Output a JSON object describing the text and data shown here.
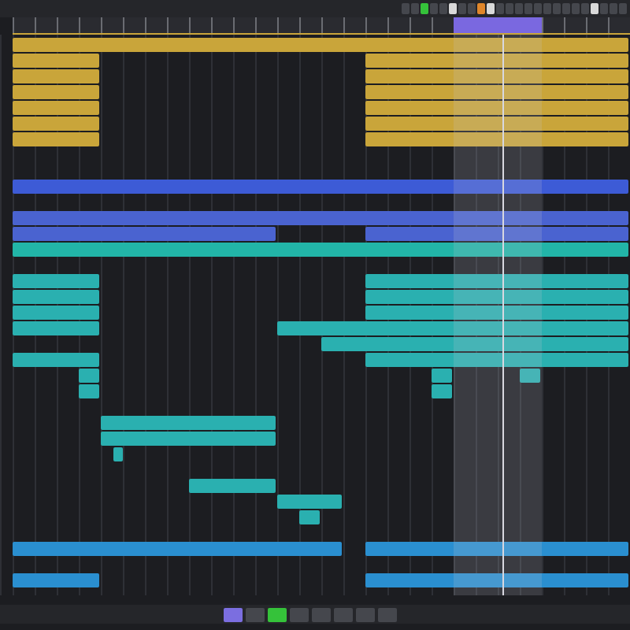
{
  "toolbar": {
    "buttons": [
      {
        "selected": false
      },
      {
        "selected": false
      },
      {
        "selected": true,
        "color": "#35c23a"
      },
      {
        "selected": false
      },
      {
        "selected": false
      },
      {
        "selected": true,
        "color": "#d9d9d9"
      },
      {
        "selected": false
      },
      {
        "selected": false
      },
      {
        "selected": true,
        "color": "#e0862a"
      },
      {
        "selected": true,
        "color": "#d9d9d9"
      },
      {
        "selected": false
      },
      {
        "selected": false
      },
      {
        "selected": false
      },
      {
        "selected": false
      },
      {
        "selected": false
      },
      {
        "selected": false
      },
      {
        "selected": false
      },
      {
        "selected": false
      },
      {
        "selected": false
      },
      {
        "selected": false
      },
      {
        "selected": true,
        "color": "#d9d9d9"
      },
      {
        "selected": false
      },
      {
        "selected": false
      },
      {
        "selected": false
      }
    ]
  },
  "tracks": [
    {
      "color": "#c9a53a"
    },
    {
      "color": "#c9a53a"
    },
    {
      "color": "#c9a53a"
    },
    {
      "color": "#c9a53a"
    },
    {
      "color": "#c9a53a"
    },
    {
      "color": "#c9a53a"
    },
    {
      "color": "#c9a53a"
    },
    {
      "color": "#3d5bd6"
    },
    {
      "color": "#4a63d0"
    },
    {
      "color": "#4a63d0"
    },
    {
      "color": "#22b5a8"
    },
    {
      "color": "#2ab0b0"
    },
    {
      "color": "#2ab0b0"
    },
    {
      "color": "#2ab0b0"
    },
    {
      "color": "#2ab0b0"
    },
    {
      "color": "#2ab0b0"
    },
    {
      "color": "#2ab0b0"
    },
    {
      "color": "#2ab0b0"
    },
    {
      "color": "#2ab0b0"
    },
    {
      "color": "#2ab0b0"
    },
    {
      "color": "#2ab0b0"
    },
    {
      "color": "#2ab0b0"
    },
    {
      "color": "#2ab0b0"
    },
    {
      "color": "#2ab0b0"
    },
    {
      "color": "#2ab0b0"
    },
    {
      "color": "#2a8fd0"
    },
    {
      "color": "#2a8fd0"
    }
  ],
  "transport": {
    "buttons": [
      {
        "selected": true,
        "color": "#7b6ee0"
      },
      {
        "selected": false
      },
      {
        "selected": true,
        "color": "#35c23a"
      },
      {
        "selected": false
      },
      {
        "selected": false
      },
      {
        "selected": false
      },
      {
        "selected": false
      },
      {
        "selected": false
      }
    ]
  }
}
